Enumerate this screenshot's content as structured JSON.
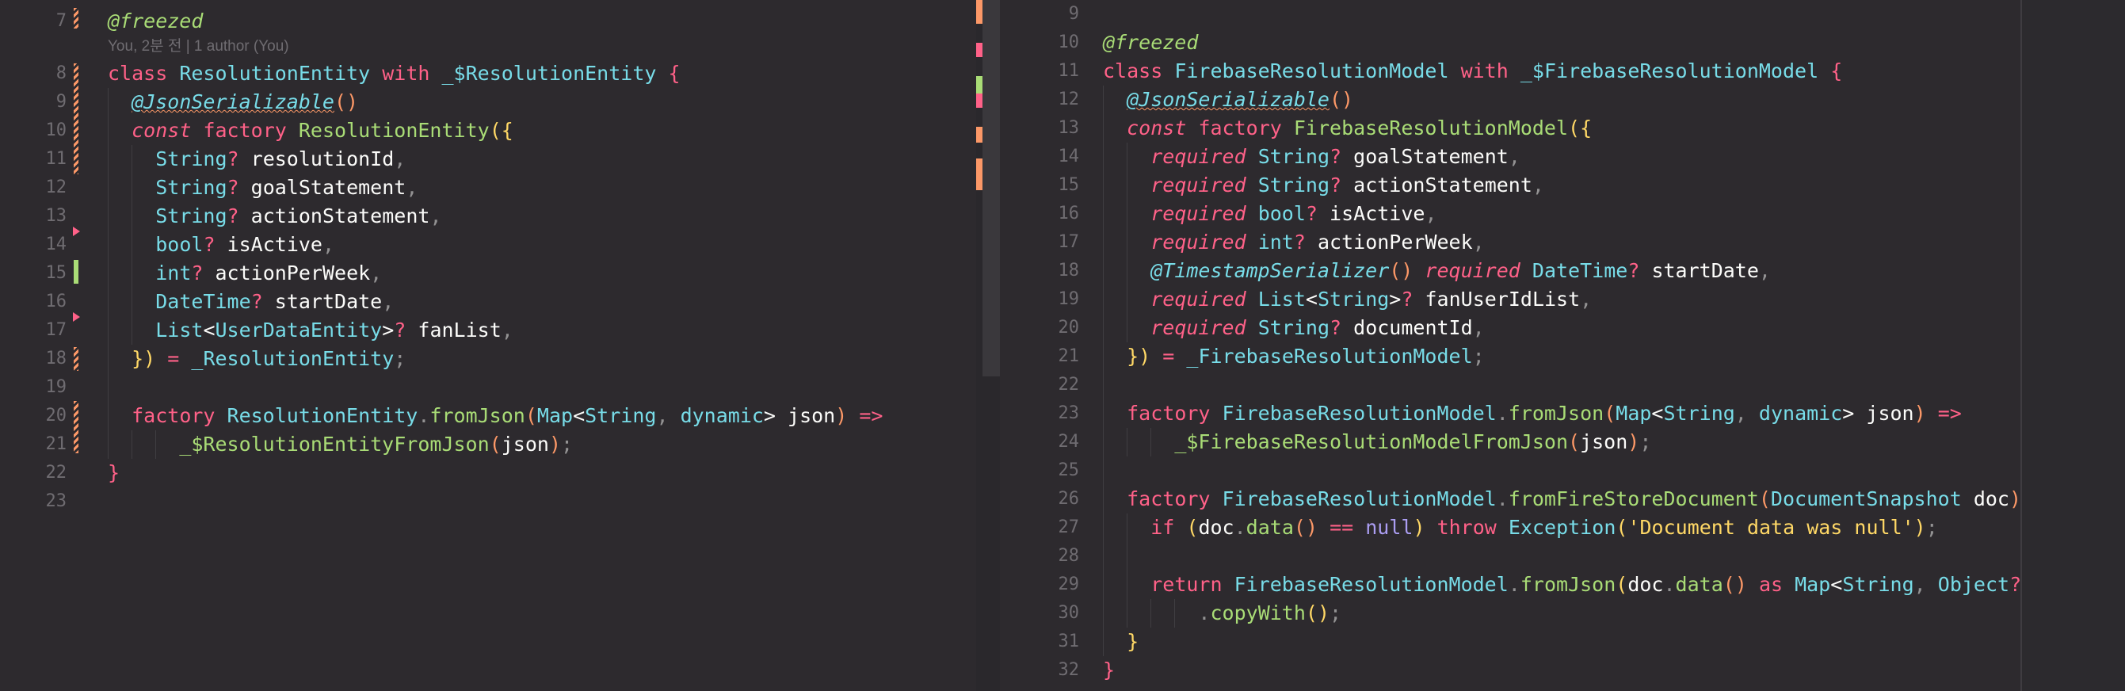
{
  "colors": {
    "background": "#2d2a2e",
    "keyword": "#ff6188",
    "type": "#78dce8",
    "function": "#a9dc76",
    "bracket": "#fc9867",
    "string": "#ffd866",
    "null": "#ab9df2",
    "line_number": "#6f6c71"
  },
  "left_pane": {
    "blame_text": "You, 2분 전 | 1 author (You)",
    "lines": [
      {
        "num": "7"
      },
      {
        "num": "8"
      },
      {
        "num": "9"
      },
      {
        "num": "10"
      },
      {
        "num": "11"
      },
      {
        "num": "12"
      },
      {
        "num": "13"
      },
      {
        "num": "14"
      },
      {
        "num": "15"
      },
      {
        "num": "16"
      },
      {
        "num": "17"
      },
      {
        "num": "18"
      },
      {
        "num": "19"
      },
      {
        "num": "20"
      },
      {
        "num": "21"
      },
      {
        "num": "22"
      },
      {
        "num": "23"
      }
    ],
    "tokens": {
      "l7": "@freezed",
      "l8_class": "class",
      "l8_name": "ResolutionEntity",
      "l8_with": "with",
      "l8_mixin": "_$ResolutionEntity",
      "l8_brace": "{",
      "l9_ann": "@JsonSerializable",
      "l9_paren": "()",
      "l10_const": "const",
      "l10_factory": "factory",
      "l10_name": "ResolutionEntity",
      "l10_open": "({",
      "f1_type": "String",
      "f1_name": "resolutionId",
      "f2_type": "String",
      "f2_name": "goalStatement",
      "f3_type": "String",
      "f3_name": "actionStatement",
      "f4_type": "bool",
      "f4_name": "isActive",
      "f5_type": "int",
      "f5_name": "actionPerWeek",
      "f6_type": "DateTime",
      "f6_name": "startDate",
      "f7_type": "List",
      "f7_inner": "UserDataEntity",
      "f7_name": "fanList",
      "l18_close": "})",
      "l18_eq": "=",
      "l18_impl": "_ResolutionEntity",
      "l20_factory": "factory",
      "l20_name": "ResolutionEntity",
      "l20_method": "fromJson",
      "l20_map": "Map",
      "l20_string": "String",
      "l20_dynamic": "dynamic",
      "l20_json": "json",
      "l20_arrow": "=>",
      "l21_fn": "_$ResolutionEntityFromJson",
      "l21_arg": "json",
      "l22_brace": "}"
    }
  },
  "right_pane": {
    "lines": [
      {
        "num": "9"
      },
      {
        "num": "10"
      },
      {
        "num": "11"
      },
      {
        "num": "12"
      },
      {
        "num": "13"
      },
      {
        "num": "14"
      },
      {
        "num": "15"
      },
      {
        "num": "16"
      },
      {
        "num": "17"
      },
      {
        "num": "18"
      },
      {
        "num": "19"
      },
      {
        "num": "20"
      },
      {
        "num": "21"
      },
      {
        "num": "22"
      },
      {
        "num": "23"
      },
      {
        "num": "24"
      },
      {
        "num": "25"
      },
      {
        "num": "26"
      },
      {
        "num": "27"
      },
      {
        "num": "28"
      },
      {
        "num": "29"
      },
      {
        "num": "30"
      },
      {
        "num": "31"
      },
      {
        "num": "32"
      }
    ],
    "tokens": {
      "r10": "@freezed",
      "r11_class": "class",
      "r11_name": "FirebaseResolutionModel",
      "r11_with": "with",
      "r11_mixin": "_$FirebaseResolutionModel",
      "r11_brace": "{",
      "r12_ann": "@JsonSerializable",
      "r12_paren": "()",
      "r13_const": "const",
      "r13_factory": "factory",
      "r13_name": "FirebaseResolutionModel",
      "r13_open": "({",
      "required": "required",
      "g1_type": "String",
      "g1_name": "goalStatement",
      "g2_type": "String",
      "g2_name": "actionStatement",
      "g3_type": "bool",
      "g3_name": "isActive",
      "g4_type": "int",
      "g4_name": "actionPerWeek",
      "g5_ann": "@TimestampSerializer",
      "g5_paren": "()",
      "g5_type": "DateTime",
      "g5_name": "startDate",
      "g6_type": "List",
      "g6_inner": "String",
      "g6_name": "fanUserIdList",
      "g7_type": "String",
      "g7_name": "documentId",
      "r21_close": "})",
      "r21_eq": "=",
      "r21_impl": "_FirebaseResolutionModel",
      "r23_factory": "factory",
      "r23_name": "FirebaseResolutionModel",
      "r23_method": "fromJson",
      "r23_map": "Map",
      "r23_string": "String",
      "r23_dynamic": "dynamic",
      "r23_json": "json",
      "r23_arrow": "=>",
      "r24_fn": "_$FirebaseResolutionModelFromJson",
      "r24_arg": "json",
      "r26_factory": "factory",
      "r26_name": "FirebaseResolutionModel",
      "r26_method": "fromFireStoreDocument",
      "r26_type": "DocumentSnapshot",
      "r26_param": "doc",
      "r26_brace": "{",
      "r27_if": "if",
      "r27_doc": "doc",
      "r27_data": "data",
      "r27_op": "==",
      "r27_null": "null",
      "r27_throw": "throw",
      "r27_exc": "Exception",
      "r27_str": "'Document data was null'",
      "r29_return": "return",
      "r29_name": "FirebaseResolutionModel",
      "r29_method": "fromJson",
      "r29_doc": "doc",
      "r29_data": "data",
      "r29_as": "as",
      "r29_map": "Map",
      "r29_string": "String",
      "r29_object": "Object",
      "r30_method": "copyWith",
      "r31_brace": "}",
      "r32_brace": "}"
    }
  }
}
